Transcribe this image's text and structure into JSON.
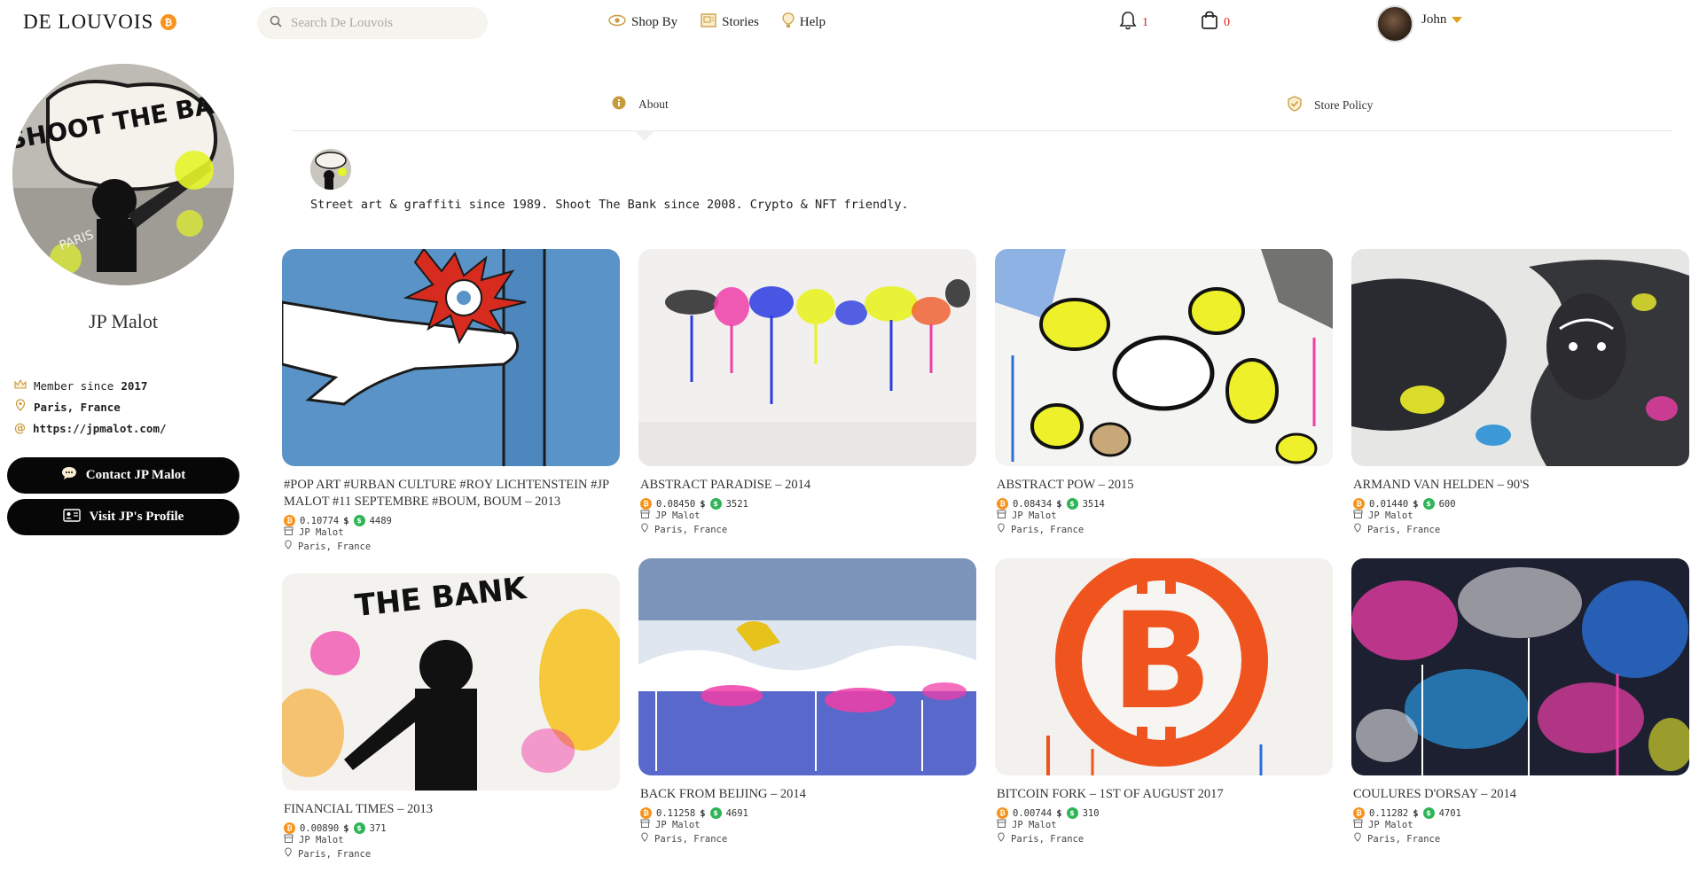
{
  "brand": {
    "name": "DE LOUVOIS",
    "badge": "₿"
  },
  "search": {
    "placeholder": "Search De Louvois"
  },
  "nav": [
    {
      "label": "Shop By",
      "icon": "eye-icon"
    },
    {
      "label": "Stories",
      "icon": "stories-icon"
    },
    {
      "label": "Help",
      "icon": "help-icon"
    }
  ],
  "header": {
    "notifications_count": "1",
    "cart_count": "0",
    "user_name": "John"
  },
  "seller": {
    "name": "JP Malot",
    "member_since_label": "Member since",
    "member_since_year": "2017",
    "location": "Paris, France",
    "website": "https://jpmalot.com/",
    "contact_label": "Contact JP Malot",
    "profile_label": "Visit JP's Profile",
    "avatar_caption": "SHOOT THE BANK"
  },
  "tabs": {
    "about": "About",
    "store_policy": "Store Policy"
  },
  "bio": "Street art & graffiti since 1989. Shoot The Bank since 2008. Crypto & NFT friendly.",
  "products": [
    {
      "title": "#POP ART #URBAN CULTURE #ROY LICHTENSTEIN #JP MALOT #11 SEPTEMBRE #BOUM, BOUM – 2013",
      "btc": "0.10774",
      "usd": "4489",
      "artist": "JP Malot",
      "location": "Paris, France"
    },
    {
      "title": "ABSTRACT PARADISE – 2014",
      "btc": "0.08450",
      "usd": "3521",
      "artist": "JP Malot",
      "location": "Paris, France"
    },
    {
      "title": "ABSTRACT POW – 2015",
      "btc": "0.08434",
      "usd": "3514",
      "artist": "JP Malot",
      "location": "Paris, France"
    },
    {
      "title": "ARMAND VAN HELDEN – 90'S",
      "btc": "0.01440",
      "usd": "600",
      "artist": "JP Malot",
      "location": "Paris, France"
    },
    {
      "title": "FINANCIAL TIMES – 2013",
      "btc": "0.00890",
      "usd": "371",
      "artist": "JP Malot",
      "location": "Paris, France"
    },
    {
      "title": "BACK FROM BEIJING – 2014",
      "btc": "0.11258",
      "usd": "4691",
      "artist": "JP Malot",
      "location": "Paris, France"
    },
    {
      "title": "BITCOIN FORK – 1ST OF AUGUST 2017",
      "btc": "0.00744",
      "usd": "310",
      "artist": "JP Malot",
      "location": "Paris, France"
    },
    {
      "title": "COULURES D'ORSAY – 2014",
      "btc": "0.11282",
      "usd": "4701",
      "artist": "JP Malot",
      "location": "Paris, France"
    }
  ],
  "colors": {
    "accent": "#e0a21c",
    "bitcoin": "#f7931a",
    "dollar": "#2fb457",
    "button": "#070707",
    "alert": "#dd2222"
  }
}
